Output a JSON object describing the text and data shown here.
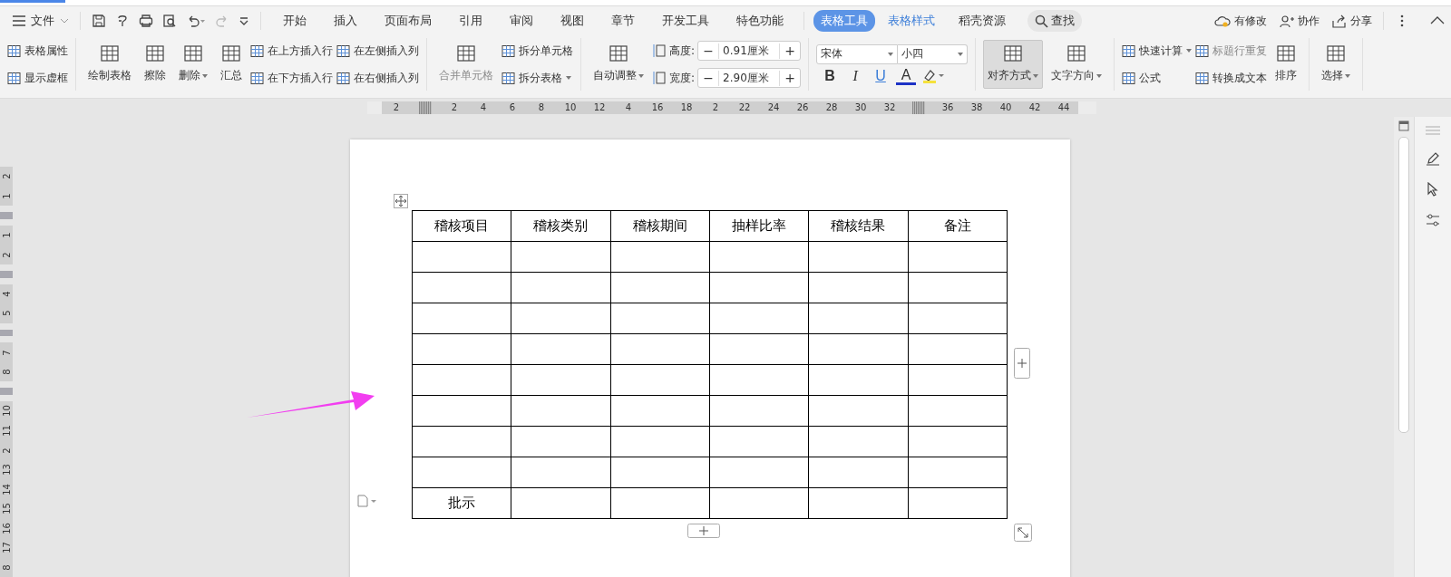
{
  "menu": {
    "file": "文件",
    "tabs": [
      {
        "label": "开始",
        "kind": "plain",
        "selected": false
      },
      {
        "label": "插入",
        "kind": "plain",
        "selected": false
      },
      {
        "label": "页面布局",
        "kind": "plain",
        "selected": false
      },
      {
        "label": "引用",
        "kind": "plain",
        "selected": false
      },
      {
        "label": "审阅",
        "kind": "plain",
        "selected": false
      },
      {
        "label": "视图",
        "kind": "plain",
        "selected": false
      },
      {
        "label": "章节",
        "kind": "plain",
        "selected": false
      },
      {
        "label": "开发工具",
        "kind": "plain",
        "selected": false
      },
      {
        "label": "特色功能",
        "kind": "plain",
        "selected": false
      },
      {
        "label": "表格工具",
        "kind": "context",
        "selected": true
      },
      {
        "label": "表格样式",
        "kind": "context",
        "selected": false
      },
      {
        "label": "稻壳资源",
        "kind": "plain",
        "selected": false
      }
    ],
    "search": "查找",
    "actions": [
      "有修改",
      "协作",
      "分享"
    ]
  },
  "ribbon": {
    "groups": [
      {
        "columns": [
          [
            {
              "kind": "small",
              "label": "表格属性"
            },
            {
              "kind": "small",
              "label": "显示虚框"
            }
          ]
        ]
      },
      {
        "columns": [
          [
            {
              "kind": "large",
              "label": "绘制表格"
            }
          ],
          [
            {
              "kind": "large",
              "label": "擦除"
            }
          ],
          [
            {
              "kind": "large",
              "label": "删除",
              "dropdown": true
            }
          ],
          [
            {
              "kind": "large",
              "label": "汇总"
            }
          ],
          [
            {
              "kind": "small",
              "label": "在上方插入行"
            },
            {
              "kind": "small",
              "label": "在下方插入行"
            }
          ],
          [
            {
              "kind": "small",
              "label": "在左侧插入列"
            },
            {
              "kind": "small",
              "label": "在右侧插入列"
            }
          ]
        ]
      },
      {
        "columns": [
          [
            {
              "kind": "large",
              "label": "合并单元格",
              "disabled": true
            }
          ],
          [
            {
              "kind": "small",
              "label": "拆分单元格"
            },
            {
              "kind": "small",
              "label": "拆分表格",
              "dropdown": true
            }
          ]
        ]
      },
      {
        "columns": [
          [
            {
              "kind": "large",
              "label": "自动调整",
              "dropdown": true
            }
          ],
          [
            {
              "kind": "spin",
              "label": "高度:",
              "value": "0.91厘米",
              "minus": "−",
              "plus": "+"
            },
            {
              "kind": "spin",
              "label": "宽度:",
              "value": "2.90厘米",
              "minus": "−",
              "plus": "+"
            }
          ]
        ]
      },
      {
        "columns": [
          [
            {
              "kind": "font",
              "font": "宋体",
              "size": "小四",
              "bold": "B",
              "italic": "I",
              "underline": "U",
              "font_color": "A"
            }
          ]
        ]
      },
      {
        "columns": [
          [
            {
              "kind": "large",
              "label": "对齐方式",
              "dropdown": true,
              "selected": true
            }
          ],
          [
            {
              "kind": "large",
              "label": "文字方向",
              "dropdown": true,
              "selected": false
            }
          ]
        ]
      },
      {
        "columns": [
          [
            {
              "kind": "small",
              "label": "快速计算",
              "dropdown": true
            },
            {
              "kind": "small",
              "label": "公式"
            }
          ],
          [
            {
              "kind": "small",
              "label": "标题行重复",
              "disabled": true
            },
            {
              "kind": "small",
              "label": "转换成文本"
            }
          ],
          [
            {
              "kind": "large",
              "label": "排序"
            }
          ]
        ]
      },
      {
        "columns": [
          [
            {
              "kind": "large",
              "label": "选择",
              "dropdown": true
            }
          ]
        ]
      }
    ]
  },
  "ruler": [
    {
      "kind": "label",
      "text": "2"
    },
    {
      "kind": "marker"
    },
    {
      "kind": "label",
      "text": "2"
    },
    {
      "kind": "label",
      "text": "4"
    },
    {
      "kind": "label",
      "text": "6"
    },
    {
      "kind": "label",
      "text": "8"
    },
    {
      "kind": "label",
      "text": "10"
    },
    {
      "kind": "label",
      "text": "12"
    },
    {
      "kind": "label",
      "text": "4"
    },
    {
      "kind": "label",
      "text": "16"
    },
    {
      "kind": "label",
      "text": "18"
    },
    {
      "kind": "label",
      "text": "2"
    },
    {
      "kind": "label",
      "text": "22"
    },
    {
      "kind": "label",
      "text": "24"
    },
    {
      "kind": "label",
      "text": "26"
    },
    {
      "kind": "label",
      "text": "28"
    },
    {
      "kind": "label",
      "text": "30"
    },
    {
      "kind": "label",
      "text": "32"
    },
    {
      "kind": "marker"
    },
    {
      "kind": "label",
      "text": "36"
    },
    {
      "kind": "label",
      "text": "38"
    },
    {
      "kind": "label",
      "text": "40"
    },
    {
      "kind": "label",
      "text": "42"
    },
    {
      "kind": "label",
      "text": "44"
    }
  ],
  "vruler": [
    {
      "kind": "label",
      "text": "2"
    },
    {
      "kind": "label",
      "text": "1"
    },
    {
      "kind": "marker"
    },
    {
      "kind": "label",
      "text": "1"
    },
    {
      "kind": "label",
      "text": "2"
    },
    {
      "kind": "marker"
    },
    {
      "kind": "label",
      "text": "4"
    },
    {
      "kind": "label",
      "text": "5"
    },
    {
      "kind": "marker"
    },
    {
      "kind": "label",
      "text": "7"
    },
    {
      "kind": "label",
      "text": "8"
    },
    {
      "kind": "marker"
    },
    {
      "kind": "label",
      "text": "10"
    },
    {
      "kind": "label",
      "text": "11"
    },
    {
      "kind": "label",
      "text": "2"
    },
    {
      "kind": "label",
      "text": "13"
    },
    {
      "kind": "label",
      "text": "14"
    },
    {
      "kind": "label",
      "text": "15"
    },
    {
      "kind": "label",
      "text": "16"
    },
    {
      "kind": "label",
      "text": "17"
    },
    {
      "kind": "label",
      "text": "8"
    }
  ],
  "table": {
    "header": [
      "稽核项目",
      "稽核类别",
      "稽核期间",
      "抽样比率",
      "稽核结果",
      "备注"
    ],
    "footer": [
      "批示"
    ]
  }
}
